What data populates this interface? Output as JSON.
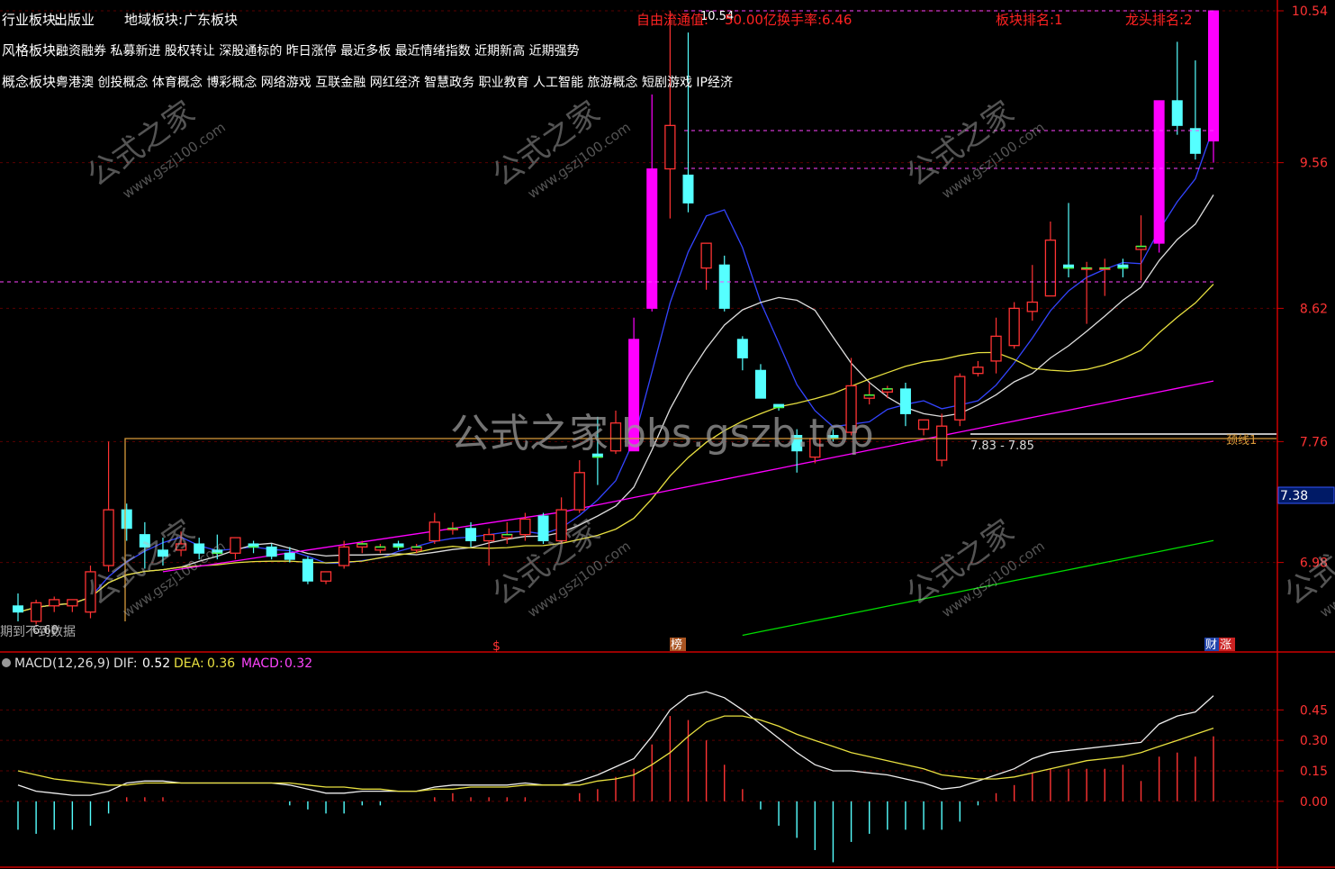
{
  "header": {
    "industry_label": "行业板块:",
    "industry_value": "出版业",
    "region_label": "地域板块:",
    "region_value": "广东板块",
    "style_label": "风格板块:",
    "style_value": "融资融券 私募新进 股权转让 深股通标的 昨日涨停 最近多板 最近情绪指数 近期新高 近期强势",
    "concept_label": "概念板块:",
    "concept_value": "粤港澳 创投概念 体育概念 博彩概念 网络游戏 互联金融 网红经济 智慧政务 职业教育 人工智能 旅游概念 短剧游戏 IP经济",
    "float_cap": "自由流通值:",
    "float_cap_value": "50.00亿",
    "turnover": "换手率:6.46",
    "sector_rank": "板块排名:1",
    "leader_rank": "龙头排名:2",
    "no_data": "期到不到数据",
    "low_label": "6.60"
  },
  "watermark": {
    "center": "公式之家 bbs.gszb.top",
    "tile_cn": "公式之家",
    "tile_url": "www.gszj100.com"
  },
  "markers": {
    "dollar": "$",
    "bang": "榜",
    "cai": "财",
    "zhang": "涨"
  },
  "annotations": {
    "range": "7.83 - 7.85",
    "neckline": "颈线1",
    "high": "10.54",
    "price_tag": "7.38"
  },
  "macd": {
    "name": "MACD(12,26,9)",
    "dif_label": "DIF:",
    "dif": "0.52",
    "dea_label": "DEA:",
    "dea": "0.36",
    "macd_label": "MACD:",
    "macd": "0.32"
  },
  "colors": {
    "up": "#ff3333",
    "down": "#55ffff",
    "limit_up": "#ff00ff",
    "ma5": "#3344ff",
    "ma10": "#dddddd",
    "ma20": "#e8e040",
    "ma60": "#ff00ff",
    "ma120": "#00dd00",
    "axis": "#cc0000"
  },
  "chart_data": [
    {
      "type": "candlestick",
      "y_ticks": [
        "10.54",
        "9.56",
        "8.62",
        "7.76",
        "6.98"
      ],
      "ylim": [
        6.6,
        10.54
      ],
      "candles": [
        {
          "o": 6.7,
          "h": 6.78,
          "l": 6.6,
          "c": 6.66
        },
        {
          "o": 6.6,
          "h": 6.74,
          "l": 6.58,
          "c": 6.72
        },
        {
          "o": 6.7,
          "h": 6.76,
          "l": 6.66,
          "c": 6.74
        },
        {
          "o": 6.7,
          "h": 6.74,
          "l": 6.66,
          "c": 6.74
        },
        {
          "o": 6.66,
          "h": 6.96,
          "l": 6.62,
          "c": 6.92
        },
        {
          "o": 6.96,
          "h": 7.76,
          "l": 6.92,
          "c": 7.32
        },
        {
          "o": 7.32,
          "h": 7.36,
          "l": 7.12,
          "c": 7.2
        },
        {
          "o": 7.16,
          "h": 7.24,
          "l": 6.94,
          "c": 7.08
        },
        {
          "o": 7.06,
          "h": 7.14,
          "l": 6.96,
          "c": 7.02
        },
        {
          "o": 7.06,
          "h": 7.18,
          "l": 7.02,
          "c": 7.1
        },
        {
          "o": 7.1,
          "h": 7.14,
          "l": 7.0,
          "c": 7.04
        },
        {
          "o": 7.06,
          "h": 7.16,
          "l": 7.0,
          "c": 7.04
        },
        {
          "o": 7.04,
          "h": 7.14,
          "l": 7.0,
          "c": 7.14
        },
        {
          "o": 7.1,
          "h": 7.12,
          "l": 7.04,
          "c": 7.08
        },
        {
          "o": 7.08,
          "h": 7.1,
          "l": 7.0,
          "c": 7.02
        },
        {
          "o": 7.04,
          "h": 7.08,
          "l": 6.98,
          "c": 7.0
        },
        {
          "o": 7.0,
          "h": 7.02,
          "l": 6.84,
          "c": 6.86
        },
        {
          "o": 6.86,
          "h": 6.92,
          "l": 6.84,
          "c": 6.92
        },
        {
          "o": 6.96,
          "h": 7.12,
          "l": 6.94,
          "c": 7.08
        },
        {
          "o": 7.08,
          "h": 7.12,
          "l": 7.04,
          "c": 7.1
        },
        {
          "o": 7.06,
          "h": 7.1,
          "l": 7.04,
          "c": 7.08
        },
        {
          "o": 7.1,
          "h": 7.12,
          "l": 7.06,
          "c": 7.08
        },
        {
          "o": 7.06,
          "h": 7.1,
          "l": 7.04,
          "c": 7.08
        },
        {
          "o": 7.12,
          "h": 7.3,
          "l": 7.1,
          "c": 7.24
        },
        {
          "o": 7.2,
          "h": 7.24,
          "l": 7.16,
          "c": 7.2
        },
        {
          "o": 7.2,
          "h": 7.24,
          "l": 7.08,
          "c": 7.12
        },
        {
          "o": 7.12,
          "h": 7.2,
          "l": 6.96,
          "c": 7.16
        },
        {
          "o": 7.14,
          "h": 7.24,
          "l": 7.1,
          "c": 7.16
        },
        {
          "o": 7.16,
          "h": 7.3,
          "l": 7.12,
          "c": 7.26
        },
        {
          "o": 7.28,
          "h": 7.3,
          "l": 7.1,
          "c": 7.12
        },
        {
          "o": 7.12,
          "h": 7.4,
          "l": 7.1,
          "c": 7.32
        },
        {
          "o": 7.32,
          "h": 7.64,
          "l": 7.3,
          "c": 7.56
        },
        {
          "o": 7.68,
          "h": 7.92,
          "l": 7.48,
          "c": 7.66
        },
        {
          "o": 7.7,
          "h": 7.96,
          "l": 7.68,
          "c": 7.88
        },
        {
          "o": 7.7,
          "h": 8.56,
          "l": 7.7,
          "c": 8.42
        },
        {
          "o": 8.62,
          "h": 10.0,
          "l": 8.6,
          "c": 9.52
        },
        {
          "o": 9.52,
          "h": 10.54,
          "l": 9.2,
          "c": 9.8
        },
        {
          "o": 9.48,
          "h": 10.4,
          "l": 9.24,
          "c": 9.3
        },
        {
          "o": 8.88,
          "h": 9.02,
          "l": 8.74,
          "c": 9.04
        },
        {
          "o": 8.9,
          "h": 8.96,
          "l": 8.6,
          "c": 8.62
        },
        {
          "o": 8.42,
          "h": 8.44,
          "l": 8.22,
          "c": 8.3
        },
        {
          "o": 8.22,
          "h": 8.26,
          "l": 8.04,
          "c": 8.04
        },
        {
          "o": 8.0,
          "h": 8.0,
          "l": 7.96,
          "c": 7.98
        },
        {
          "o": 7.8,
          "h": 7.84,
          "l": 7.56,
          "c": 7.7
        },
        {
          "o": 7.66,
          "h": 7.78,
          "l": 7.62,
          "c": 7.78
        },
        {
          "o": 7.8,
          "h": 7.84,
          "l": 7.76,
          "c": 7.78
        },
        {
          "o": 7.82,
          "h": 8.3,
          "l": 7.8,
          "c": 8.12
        },
        {
          "o": 8.04,
          "h": 8.14,
          "l": 8.0,
          "c": 8.06
        },
        {
          "o": 8.08,
          "h": 8.12,
          "l": 8.04,
          "c": 8.1
        },
        {
          "o": 8.1,
          "h": 8.14,
          "l": 7.86,
          "c": 7.94
        },
        {
          "o": 7.84,
          "h": 7.9,
          "l": 7.8,
          "c": 7.9
        },
        {
          "o": 7.64,
          "h": 7.94,
          "l": 7.6,
          "c": 7.86
        },
        {
          "o": 7.9,
          "h": 8.2,
          "l": 7.86,
          "c": 8.18
        },
        {
          "o": 8.2,
          "h": 8.28,
          "l": 8.18,
          "c": 8.24
        },
        {
          "o": 8.28,
          "h": 8.56,
          "l": 8.2,
          "c": 8.44
        },
        {
          "o": 8.38,
          "h": 8.66,
          "l": 8.36,
          "c": 8.62
        },
        {
          "o": 8.6,
          "h": 8.9,
          "l": 8.54,
          "c": 8.66
        },
        {
          "o": 8.7,
          "h": 9.18,
          "l": 8.7,
          "c": 9.06
        },
        {
          "o": 8.9,
          "h": 9.3,
          "l": 8.82,
          "c": 8.88
        },
        {
          "o": 8.88,
          "h": 8.92,
          "l": 8.52,
          "c": 8.88
        },
        {
          "o": 8.88,
          "h": 8.94,
          "l": 8.7,
          "c": 8.88
        },
        {
          "o": 8.9,
          "h": 8.94,
          "l": 8.82,
          "c": 8.88
        },
        {
          "o": 9.0,
          "h": 9.22,
          "l": 8.8,
          "c": 9.02
        },
        {
          "o": 9.04,
          "h": 9.96,
          "l": 8.98,
          "c": 9.96
        },
        {
          "o": 9.96,
          "h": 10.34,
          "l": 9.74,
          "c": 9.8
        },
        {
          "o": 9.78,
          "h": 10.22,
          "l": 9.58,
          "c": 9.62
        },
        {
          "o": 9.7,
          "h": 10.54,
          "l": 9.56,
          "c": 10.54
        }
      ]
    },
    {
      "type": "macd",
      "y_ticks": [
        "0.45",
        "0.30",
        "0.15",
        "0.00"
      ],
      "ylim": [
        -0.32,
        0.62
      ],
      "dif": [
        0.08,
        0.05,
        0.04,
        0.03,
        0.03,
        0.05,
        0.09,
        0.1,
        0.1,
        0.09,
        0.09,
        0.09,
        0.09,
        0.09,
        0.09,
        0.08,
        0.06,
        0.04,
        0.04,
        0.05,
        0.05,
        0.05,
        0.05,
        0.07,
        0.08,
        0.08,
        0.08,
        0.08,
        0.09,
        0.08,
        0.08,
        0.1,
        0.13,
        0.17,
        0.21,
        0.32,
        0.45,
        0.52,
        0.54,
        0.51,
        0.45,
        0.38,
        0.31,
        0.24,
        0.18,
        0.15,
        0.15,
        0.14,
        0.13,
        0.11,
        0.09,
        0.06,
        0.07,
        0.1,
        0.13,
        0.16,
        0.21,
        0.24,
        0.25,
        0.26,
        0.27,
        0.28,
        0.29,
        0.38,
        0.42,
        0.44,
        0.52
      ],
      "dea": [
        0.15,
        0.13,
        0.11,
        0.1,
        0.09,
        0.08,
        0.08,
        0.09,
        0.09,
        0.09,
        0.09,
        0.09,
        0.09,
        0.09,
        0.09,
        0.09,
        0.08,
        0.07,
        0.07,
        0.06,
        0.06,
        0.05,
        0.05,
        0.06,
        0.06,
        0.07,
        0.07,
        0.07,
        0.08,
        0.08,
        0.08,
        0.08,
        0.1,
        0.11,
        0.13,
        0.18,
        0.24,
        0.32,
        0.39,
        0.42,
        0.42,
        0.4,
        0.37,
        0.33,
        0.3,
        0.27,
        0.24,
        0.22,
        0.2,
        0.18,
        0.16,
        0.13,
        0.12,
        0.11,
        0.11,
        0.12,
        0.14,
        0.16,
        0.18,
        0.2,
        0.21,
        0.22,
        0.24,
        0.27,
        0.3,
        0.33,
        0.36
      ],
      "macd": [
        -0.14,
        -0.16,
        -0.14,
        -0.14,
        -0.12,
        -0.06,
        0.02,
        0.02,
        0.02,
        0.0,
        0.0,
        0.0,
        0.0,
        0.0,
        0.0,
        -0.02,
        -0.04,
        -0.06,
        -0.06,
        -0.02,
        -0.02,
        0.0,
        0.0,
        0.02,
        0.04,
        0.02,
        0.02,
        0.02,
        0.02,
        0.0,
        0.0,
        0.04,
        0.06,
        0.12,
        0.16,
        0.28,
        0.42,
        0.4,
        0.3,
        0.18,
        0.06,
        -0.04,
        -0.12,
        -0.18,
        -0.24,
        -0.3,
        -0.2,
        -0.16,
        -0.14,
        -0.14,
        -0.14,
        -0.14,
        -0.1,
        -0.02,
        0.04,
        0.08,
        0.14,
        0.16,
        0.16,
        0.16,
        0.16,
        0.18,
        0.1,
        0.22,
        0.24,
        0.22,
        0.32
      ]
    }
  ]
}
